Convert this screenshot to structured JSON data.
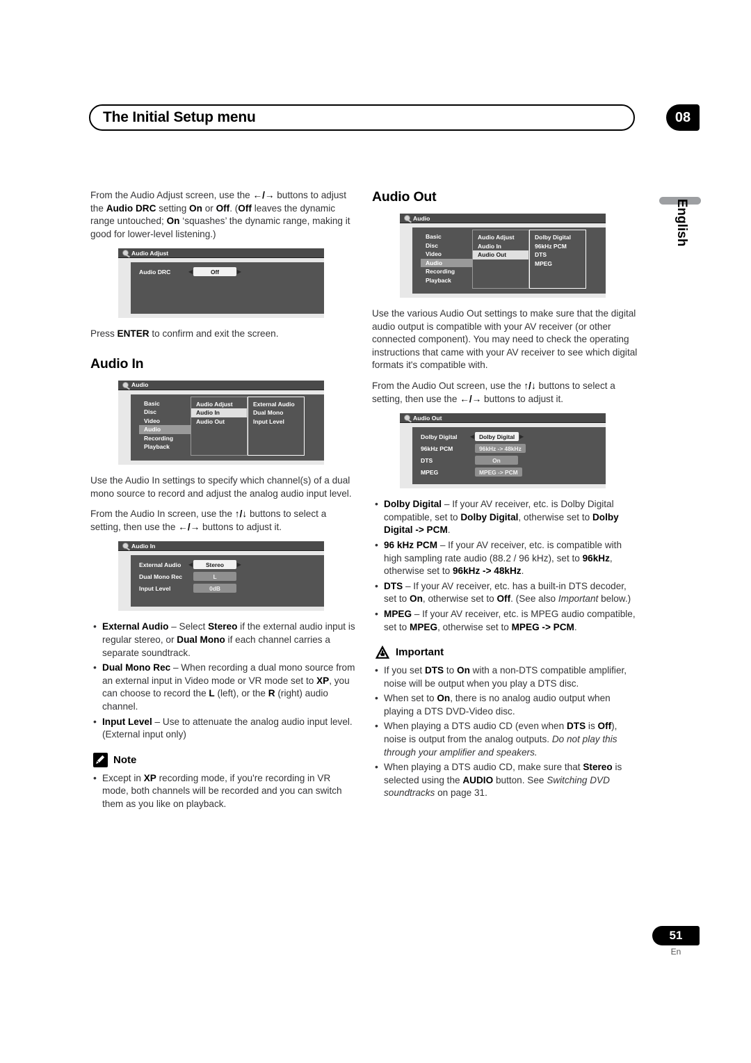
{
  "header": {
    "title": "The Initial Setup menu",
    "chapter": "08"
  },
  "side_tab": {
    "language": "English"
  },
  "footer": {
    "page_number": "51",
    "lang_code": "En"
  },
  "left_column": {
    "intro_paragraph": "From the Audio Adjust screen, use the ←/→ buttons to adjust the Audio DRC setting On or Off. (Off leaves the dynamic range untouched; On 'squashes' the dynamic range, making it good for lower-level listening.)",
    "osd_audio_adjust": {
      "title": "Audio Adjust",
      "rows": [
        {
          "label": "Audio DRC",
          "value": "Off",
          "selected": true,
          "arrows": true
        }
      ]
    },
    "press_enter": "Press ENTER to confirm and exit the screen.",
    "audio_in_heading": "Audio In",
    "osd_audio_menu": {
      "title": "Audio",
      "col1": [
        "Basic",
        "Disc",
        "Video",
        "Audio",
        "Recording",
        "Playback"
      ],
      "col1_highlight": "Audio",
      "col2": [
        "Audio Adjust",
        "Audio In",
        "Audio Out"
      ],
      "col2_highlight": "Audio In",
      "col3": [
        "External Audio",
        "Dual Mono",
        "Input Level"
      ]
    },
    "para_use_audio_in": "Use the Audio In settings to specify which channel(s) of a dual mono source to record and adjust the analog audio input level.",
    "para_from_audio_in": "From the Audio In screen, use the ↑/↓ buttons to select a setting, then use the ←/→ buttons to adjust it.",
    "osd_audio_in": {
      "title": "Audio In",
      "rows": [
        {
          "label": "External Audio",
          "value": "Stereo",
          "selected": true,
          "arrows": true
        },
        {
          "label": "Dual Mono Rec",
          "value": "L",
          "selected": false,
          "arrows": false
        },
        {
          "label": "Input Level",
          "value": "0dB",
          "selected": false,
          "arrows": false
        }
      ]
    },
    "bullets": [
      "External Audio – Select Stereo if the external audio input is regular stereo, or Dual Mono if each channel carries a separate soundtrack.",
      "Dual Mono Rec – When recording a dual mono source from an external input in Video mode or VR mode set to XP, you can choose to record the L (left), or the R (right) audio channel.",
      "Input Level – Use to attenuate the analog audio input level. (External input only)"
    ],
    "note": {
      "caption": "Note",
      "bullets": [
        "Except in XP recording mode, if you're recording in VR mode, both channels will be recorded and you can switch them as you like on playback."
      ]
    }
  },
  "right_column": {
    "audio_out_heading": "Audio Out",
    "osd_audio_menu": {
      "title": "Audio",
      "col1": [
        "Basic",
        "Disc",
        "Video",
        "Audio",
        "Recording",
        "Playback"
      ],
      "col1_highlight": "Audio",
      "col2": [
        "Audio Adjust",
        "Audio In",
        "Audio Out"
      ],
      "col2_highlight": "Audio Out",
      "col3": [
        "Dolby Digital",
        "96kHz PCM",
        "DTS",
        "MPEG"
      ]
    },
    "para_use_audio_out": "Use the various Audio Out settings to make sure that the digital audio output is compatible with your AV receiver (or other connected component). You may need to check the operating instructions that came with your AV receiver to see which digital formats it's compatible with.",
    "para_from_audio_out": "From the Audio Out screen, use the ↑/↓ buttons to select a setting, then use the ←/→ buttons to adjust it.",
    "osd_audio_out": {
      "title": "Audio Out",
      "rows": [
        {
          "label": "Dolby Digital",
          "value": "Dolby Digital",
          "selected": true,
          "arrows": true
        },
        {
          "label": "96kHz PCM",
          "value": "96kHz -> 48kHz",
          "selected": false,
          "arrows": false
        },
        {
          "label": "DTS",
          "value": "On",
          "selected": false,
          "arrows": false
        },
        {
          "label": "MPEG",
          "value": "MPEG -> PCM",
          "selected": false,
          "arrows": false
        }
      ]
    },
    "bullets": [
      "Dolby Digital – If your AV receiver, etc. is Dolby Digital compatible, set to Dolby Digital, otherwise set to Dolby Digital -> PCM.",
      "96 kHz PCM – If your AV receiver, etc. is compatible with high sampling rate audio (88.2 / 96 kHz), set to 96kHz, otherwise set to 96kHz -> 48kHz.",
      "DTS – If your AV receiver, etc. has a built-in DTS decoder, set to On, otherwise set to Off. (See also Important below.)",
      "MPEG – If your AV receiver, etc. is MPEG audio compatible, set to MPEG, otherwise set to MPEG -> PCM."
    ],
    "important": {
      "caption": "Important",
      "bullets": [
        "If you set DTS to On with a non-DTS compatible amplifier, noise will be output when you play a DTS disc.",
        "When set to On, there is no analog audio output when playing a DTS DVD-Video disc.",
        "When playing a DTS audio CD (even when DTS is Off), noise is output from the analog outputs. Do not play this through your amplifier and speakers.",
        "When playing a DTS audio CD, make sure that Stereo is selected using the AUDIO button. See Switching DVD soundtracks on page 31."
      ]
    }
  },
  "colors": {
    "osd_titlebar": "#4a4a4a",
    "osd_body": "#545454",
    "osd_frame": "#e8e8e8",
    "highlight": "#9a9a9a",
    "selected_value": "#f2f2f2",
    "accent_black": "#000000"
  }
}
